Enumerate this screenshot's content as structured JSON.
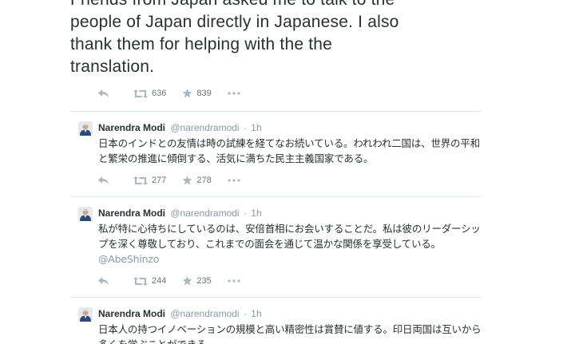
{
  "main_tweet": {
    "text": "Friends from Japan asked me to talk to the\npeople of Japan directly in Japanese. I also\nthank them for helping with the the\ntranslation.",
    "retweets": "636",
    "favorites": "839"
  },
  "tweets": [
    {
      "name": "Narendra Modi",
      "handle": "@narendramodi",
      "time": "1h",
      "text": "日本のインドとの友情は時の試練を経てなお続いている。われわれ二国は、世界の平和と繁栄の推進に傾倒する、活気に満ちた民主主義国家である。",
      "retweets": "277",
      "favorites": "278"
    },
    {
      "name": "Narendra Modi",
      "handle": "@narendramodi",
      "time": "1h",
      "text": "私が特に心待ちにしているのは、安倍首相にお会いすることだ。私は彼のリーダーシップを深く尊敬しており、これまでの面会を通じて温かな関係を享受している。",
      "mention": "@AbeShinzo",
      "retweets": "244",
      "favorites": "235"
    },
    {
      "name": "Narendra Modi",
      "handle": "@narendramodi",
      "time": "1h",
      "text": "日本人の持つイノベーションの規模と高い精密性は賞賛に値する。印日両国は互いから多くを学ぶことができる。"
    }
  ],
  "icons": {
    "reply": "reply-icon",
    "retweet": "retweet-icon",
    "favorite": "star-icon",
    "more": "more-icon"
  },
  "colors": {
    "text": "#292f33",
    "muted": "#8899a6",
    "divider": "#e1e8ed"
  }
}
